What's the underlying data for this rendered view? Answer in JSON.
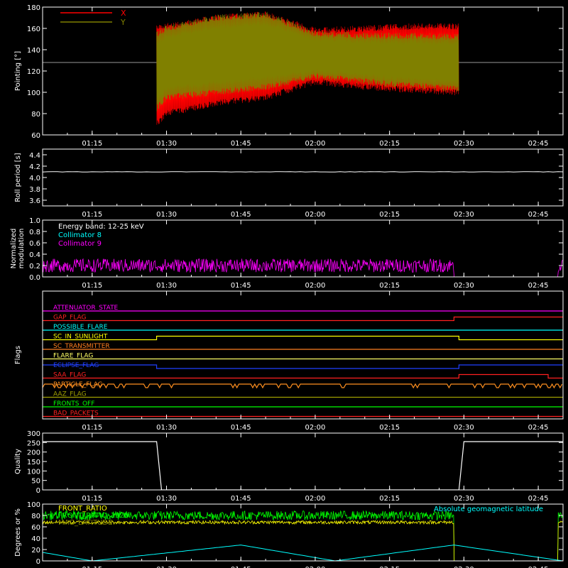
{
  "colors": {
    "background": "#000000",
    "axis": "#ffffff",
    "x_series": "#ff0000",
    "y_series": "#808000",
    "collimator8": "#00ffff",
    "collimator9": "#ff00ff",
    "front_ratio": "#ffff00",
    "front_ratio_1325": "#00ff00",
    "geomag": "#00ffff"
  },
  "time_ticks": [
    "01:15",
    "01:30",
    "01:45",
    "02:00",
    "02:15",
    "02:30",
    "02:45"
  ],
  "chart_data": [
    {
      "type": "line",
      "name": "pointing",
      "ylabel": "Pointing [°]",
      "ylim": [
        60,
        180
      ],
      "yticks": [
        "60",
        "80",
        "100",
        "120",
        "140",
        "160",
        "180"
      ],
      "legend": {
        "position": "top-left",
        "entries": [
          {
            "label": "X",
            "color": "#ff0000"
          },
          {
            "label": "Y",
            "color": "#808000"
          }
        ]
      },
      "reference_line": 128,
      "data_window": [
        "01:28",
        "02:29"
      ],
      "envelope_x": {
        "x": [
          "01:28",
          "01:30",
          "01:40",
          "01:50",
          "02:00",
          "02:10",
          "02:20",
          "02:29"
        ],
        "upper": [
          160,
          162,
          170,
          173,
          158,
          160,
          162,
          162
        ],
        "lower": [
          70,
          80,
          90,
          95,
          110,
          105,
          102,
          100
        ]
      },
      "envelope_y": {
        "x": [
          "01:28",
          "01:30",
          "01:40",
          "01:50",
          "02:00",
          "02:10",
          "02:20",
          "02:29"
        ],
        "upper": [
          155,
          160,
          170,
          173,
          155,
          153,
          153,
          152
        ],
        "lower": [
          85,
          95,
          100,
          105,
          115,
          110,
          106,
          103
        ]
      }
    },
    {
      "type": "line",
      "name": "roll-period",
      "ylabel": "Roll period [s]",
      "ylim": [
        3.5,
        4.5
      ],
      "yticks": [
        "3.6",
        "3.8",
        "4.0",
        "4.2",
        "4.4"
      ],
      "value": 4.1,
      "data_window": [
        "01:05",
        "02:50"
      ]
    },
    {
      "type": "line",
      "name": "modulation",
      "ylabel": "Normalized\nmodulation",
      "ylim": [
        0,
        1
      ],
      "yticks": [
        "0.0",
        "0.2",
        "0.4",
        "0.6",
        "0.8",
        "1.0"
      ],
      "annotations": [
        {
          "text": "Energy band: 12-25 keV",
          "color": "#ffffff"
        },
        {
          "text": "Collimator 8",
          "color": "#00ffff"
        },
        {
          "text": "Collimator 9",
          "color": "#ff00ff"
        }
      ],
      "series": [
        {
          "name": "Collimator 9",
          "color": "#ff00ff",
          "mean": 0.2,
          "noise": 0.12,
          "active": [
            [
              "01:05",
              "02:28"
            ],
            [
              "02:49",
              "02:50"
            ]
          ]
        },
        {
          "name": "Collimator 8",
          "color": "#00ffff",
          "mean": 0.0,
          "noise": 0.0,
          "active": [
            [
              "01:05",
              "02:50"
            ]
          ]
        }
      ]
    },
    {
      "type": "step",
      "name": "flags",
      "ylabel": "Flags",
      "flags": [
        {
          "label": "ATTENUATOR_STATE",
          "color": "#ff00ff",
          "steps": [
            [
              "01:05",
              0
            ]
          ]
        },
        {
          "label": "GAP_FLAG",
          "color": "#ff2020",
          "steps": [
            [
              "01:05",
              0
            ],
            [
              "02:28",
              1
            ],
            [
              "02:50",
              1
            ]
          ]
        },
        {
          "label": "POSSIBLE_FLARE",
          "color": "#00ffff",
          "steps": [
            [
              "01:05",
              0
            ]
          ]
        },
        {
          "label": "SC_IN_SUNLIGHT",
          "color": "#ffff00",
          "steps": [
            [
              "01:05",
              0
            ],
            [
              "01:28",
              1
            ],
            [
              "02:29",
              0
            ]
          ]
        },
        {
          "label": "SC_TRANSMITTER",
          "color": "#ff8020",
          "steps": [
            [
              "01:05",
              0
            ]
          ]
        },
        {
          "label": "FLARE_FLAG",
          "color": "#ffff66",
          "steps": [
            [
              "01:05",
              0
            ]
          ]
        },
        {
          "label": "ECLIPSE_FLAG",
          "color": "#2040ff",
          "steps": [
            [
              "01:05",
              1
            ],
            [
              "01:28",
              0
            ],
            [
              "02:29",
              1
            ]
          ]
        },
        {
          "label": "SAA_FLAG",
          "color": "#ff2020",
          "steps": [
            [
              "01:05",
              0
            ],
            [
              "02:29",
              1
            ],
            [
              "02:47",
              0
            ]
          ]
        },
        {
          "label": "PARTICLE_FLAG",
          "color": "#ff9020",
          "steps": [
            [
              "01:05",
              1
            ],
            [
              "01:29",
              1
            ]
          ]
        },
        {
          "label": "AAZ_FLAG",
          "color": "#a0a000",
          "steps": [
            [
              "01:05",
              0
            ]
          ]
        },
        {
          "label": "FRONTS_OFF",
          "color": "#00ff00",
          "steps": [
            [
              "01:05",
              0
            ]
          ]
        },
        {
          "label": "BAD_PACKETS",
          "color": "#ff2020",
          "steps": [
            [
              "01:05",
              0
            ]
          ]
        }
      ]
    },
    {
      "type": "line",
      "name": "quality",
      "ylabel": "Quality",
      "ylim": [
        0,
        300
      ],
      "yticks": [
        "0",
        "50",
        "100",
        "150",
        "200",
        "250",
        "300"
      ],
      "steps": [
        [
          "01:05",
          255
        ],
        [
          "01:28",
          255
        ],
        [
          "01:29",
          0
        ],
        [
          "02:29",
          0
        ],
        [
          "02:30",
          255
        ],
        [
          "02:50",
          255
        ]
      ]
    },
    {
      "type": "line",
      "name": "degrees",
      "ylabel": "Degrees or %",
      "ylim": [
        0,
        100
      ],
      "yticks": [
        "0",
        "20",
        "40",
        "60",
        "80",
        "100"
      ],
      "legend": {
        "position": "top-left",
        "entries": [
          {
            "label": "FRONT_RATIO",
            "color": "#ffff00"
          },
          {
            "label": "FRONT_RATIO_1325",
            "color": "#00ff00"
          },
          {
            "label": "MAG_LATITUDE",
            "color": "#808000"
          }
        ]
      },
      "annotation_right": {
        "text": "Absolute geomagnetic latitude",
        "color": "#00ffff"
      },
      "series": [
        {
          "name": "FRONT_RATIO_1325",
          "color": "#00ff00",
          "mean": 80,
          "noise": 8,
          "active": [
            [
              "01:05",
              "02:28"
            ],
            [
              "02:49",
              "02:50"
            ]
          ]
        },
        {
          "name": "FRONT_RATIO",
          "color": "#ffff00",
          "mean": 68,
          "noise": 3,
          "active": [
            [
              "01:05",
              "02:28"
            ],
            [
              "02:49",
              "02:50"
            ]
          ]
        }
      ],
      "geomag": {
        "x": [
          "01:05",
          "01:15",
          "01:45",
          "02:04",
          "02:28",
          "02:50"
        ],
        "y": [
          15,
          0,
          28,
          0,
          28,
          0
        ]
      }
    }
  ]
}
